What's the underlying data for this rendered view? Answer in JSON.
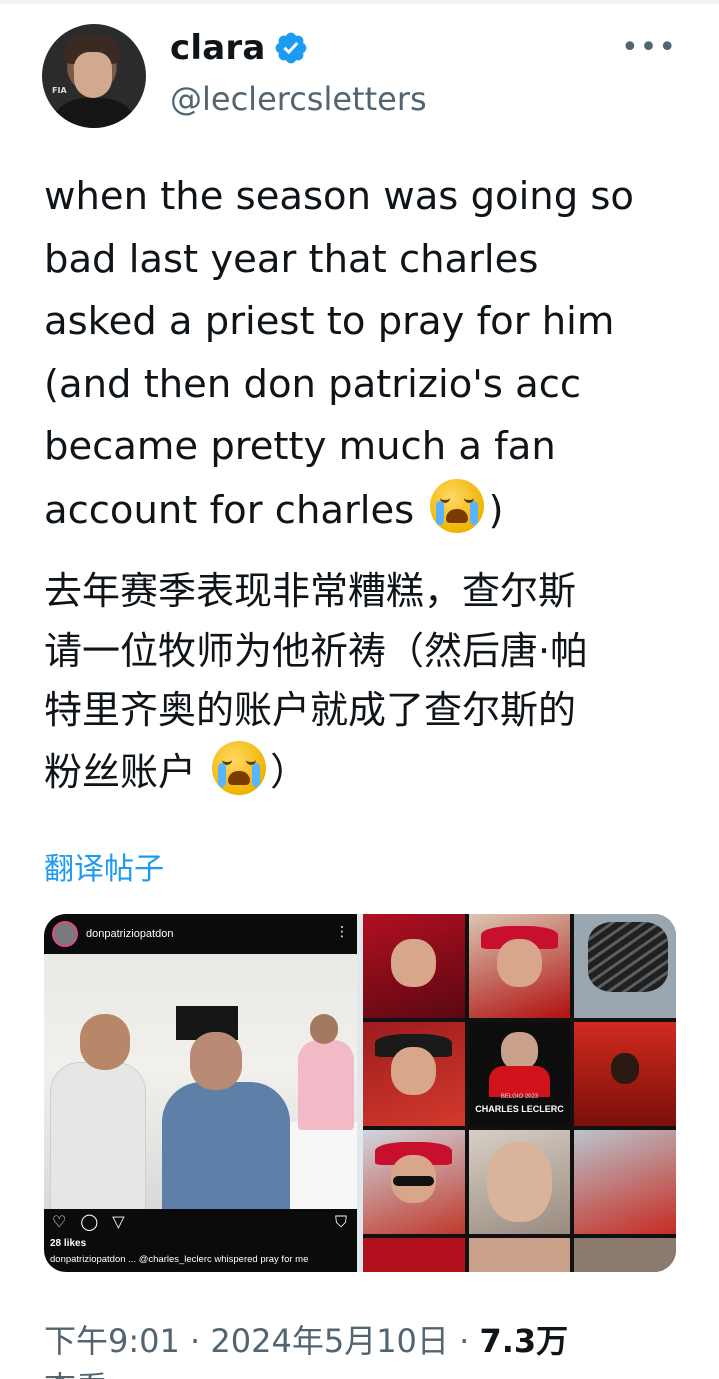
{
  "author": {
    "display_name": "clara",
    "handle": "@leclercsletters",
    "verified": true,
    "avatar_badge": "FIA"
  },
  "tweet": {
    "text_en": "when the season was going so\nbad last year that charles\nasked a priest to pray for him\n(and then don patrizio's acc\nbecame pretty much a fan\naccount for charles ",
    "text_en_end": ")",
    "text_zh": "去年赛季表现非常糟糕，查尔斯\n请一位牧师为他祈祷（然后唐·帕\n特里齐奥的账户就成了查尔斯的\n粉丝账户 ",
    "text_zh_end": "）",
    "emoji": "loudly-crying-face",
    "translate_label": "翻译帖子"
  },
  "media": {
    "left": {
      "username": "donpatriziopatdon",
      "likes": "28 likes",
      "caption": "donpatriziopatdon ... @charles_leclerc whispered pray for me"
    },
    "right": {
      "label_small": "BELGIO 2023",
      "label_main": "CHARLES LECLERC"
    }
  },
  "footer": {
    "time": "下午9:01",
    "sep1": " · ",
    "date": "2024年5月10日",
    "sep2": " · ",
    "views": "7.3万",
    "views_label": "查看"
  },
  "colors": {
    "accent": "#1d9bf0",
    "secondary_text": "#536471",
    "primary_text": "#0f1419"
  },
  "icons": [
    "verified-badge-icon",
    "more-icon",
    "heart-icon",
    "comment-icon",
    "share-icon",
    "bookmark-icon"
  ]
}
